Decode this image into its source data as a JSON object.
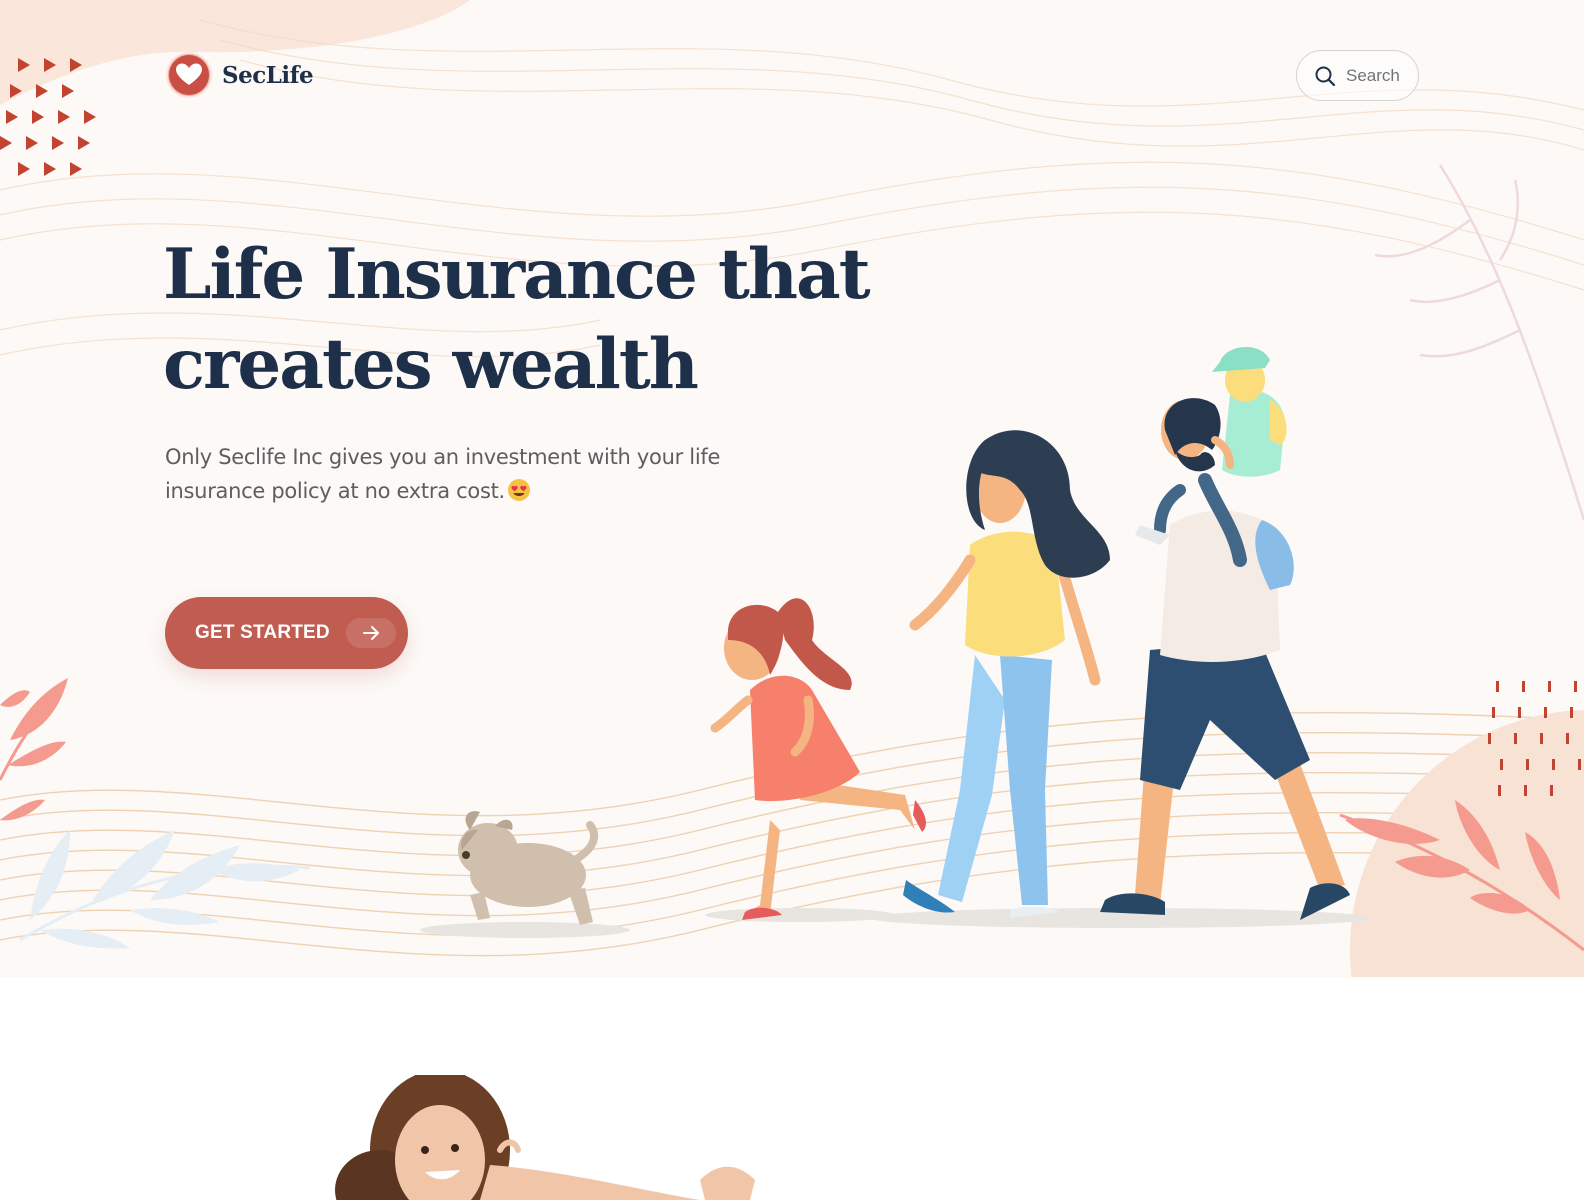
{
  "brand": {
    "name": "SecLife"
  },
  "search": {
    "placeholder": "Search"
  },
  "hero": {
    "headline": "Life Insurance that creates wealth",
    "subtext": "Only Seclife Inc gives you an investment with your life insurance policy at no extra cost.",
    "cta_label": "GET STARTED"
  },
  "icons": {
    "logo": "heart-icon",
    "search": "search-icon",
    "cta": "arrow-right-icon",
    "emoji": "heart-eyes-emoji-icon"
  },
  "colors": {
    "primary": "#c15d50",
    "heading": "#1e3049",
    "hero_background": "#fcf9f7",
    "body_text": "#5c5e61"
  }
}
